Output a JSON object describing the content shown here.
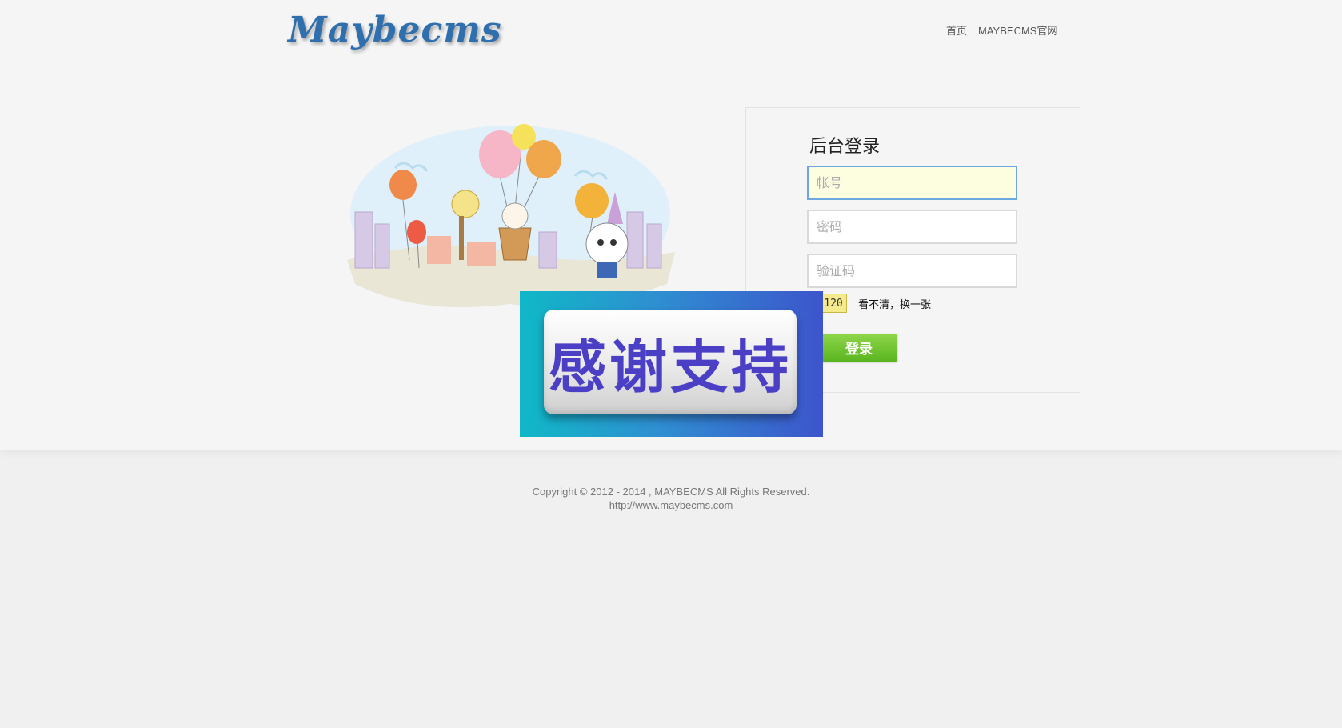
{
  "header": {
    "logo_text": "Maybecms",
    "nav": [
      {
        "label": "首页"
      },
      {
        "label": "MAYBECMS官网"
      }
    ]
  },
  "login": {
    "title": "后台登录",
    "username_placeholder": "帐号",
    "password_placeholder": "密码",
    "captcha_placeholder": "验证码",
    "captcha_code": "120",
    "refresh_label": "看不清，换一张",
    "submit_label": "登录"
  },
  "banner": {
    "text": "感谢支持"
  },
  "footer": {
    "copyright": "Copyright © 2012 - 2014 , MAYBECMS All Rights Reserved.",
    "url": "http://www.maybecms.com"
  },
  "colors": {
    "accent_blue": "#2f6fae",
    "button_green": "#6ec030",
    "focus_border": "#6aa8df"
  }
}
